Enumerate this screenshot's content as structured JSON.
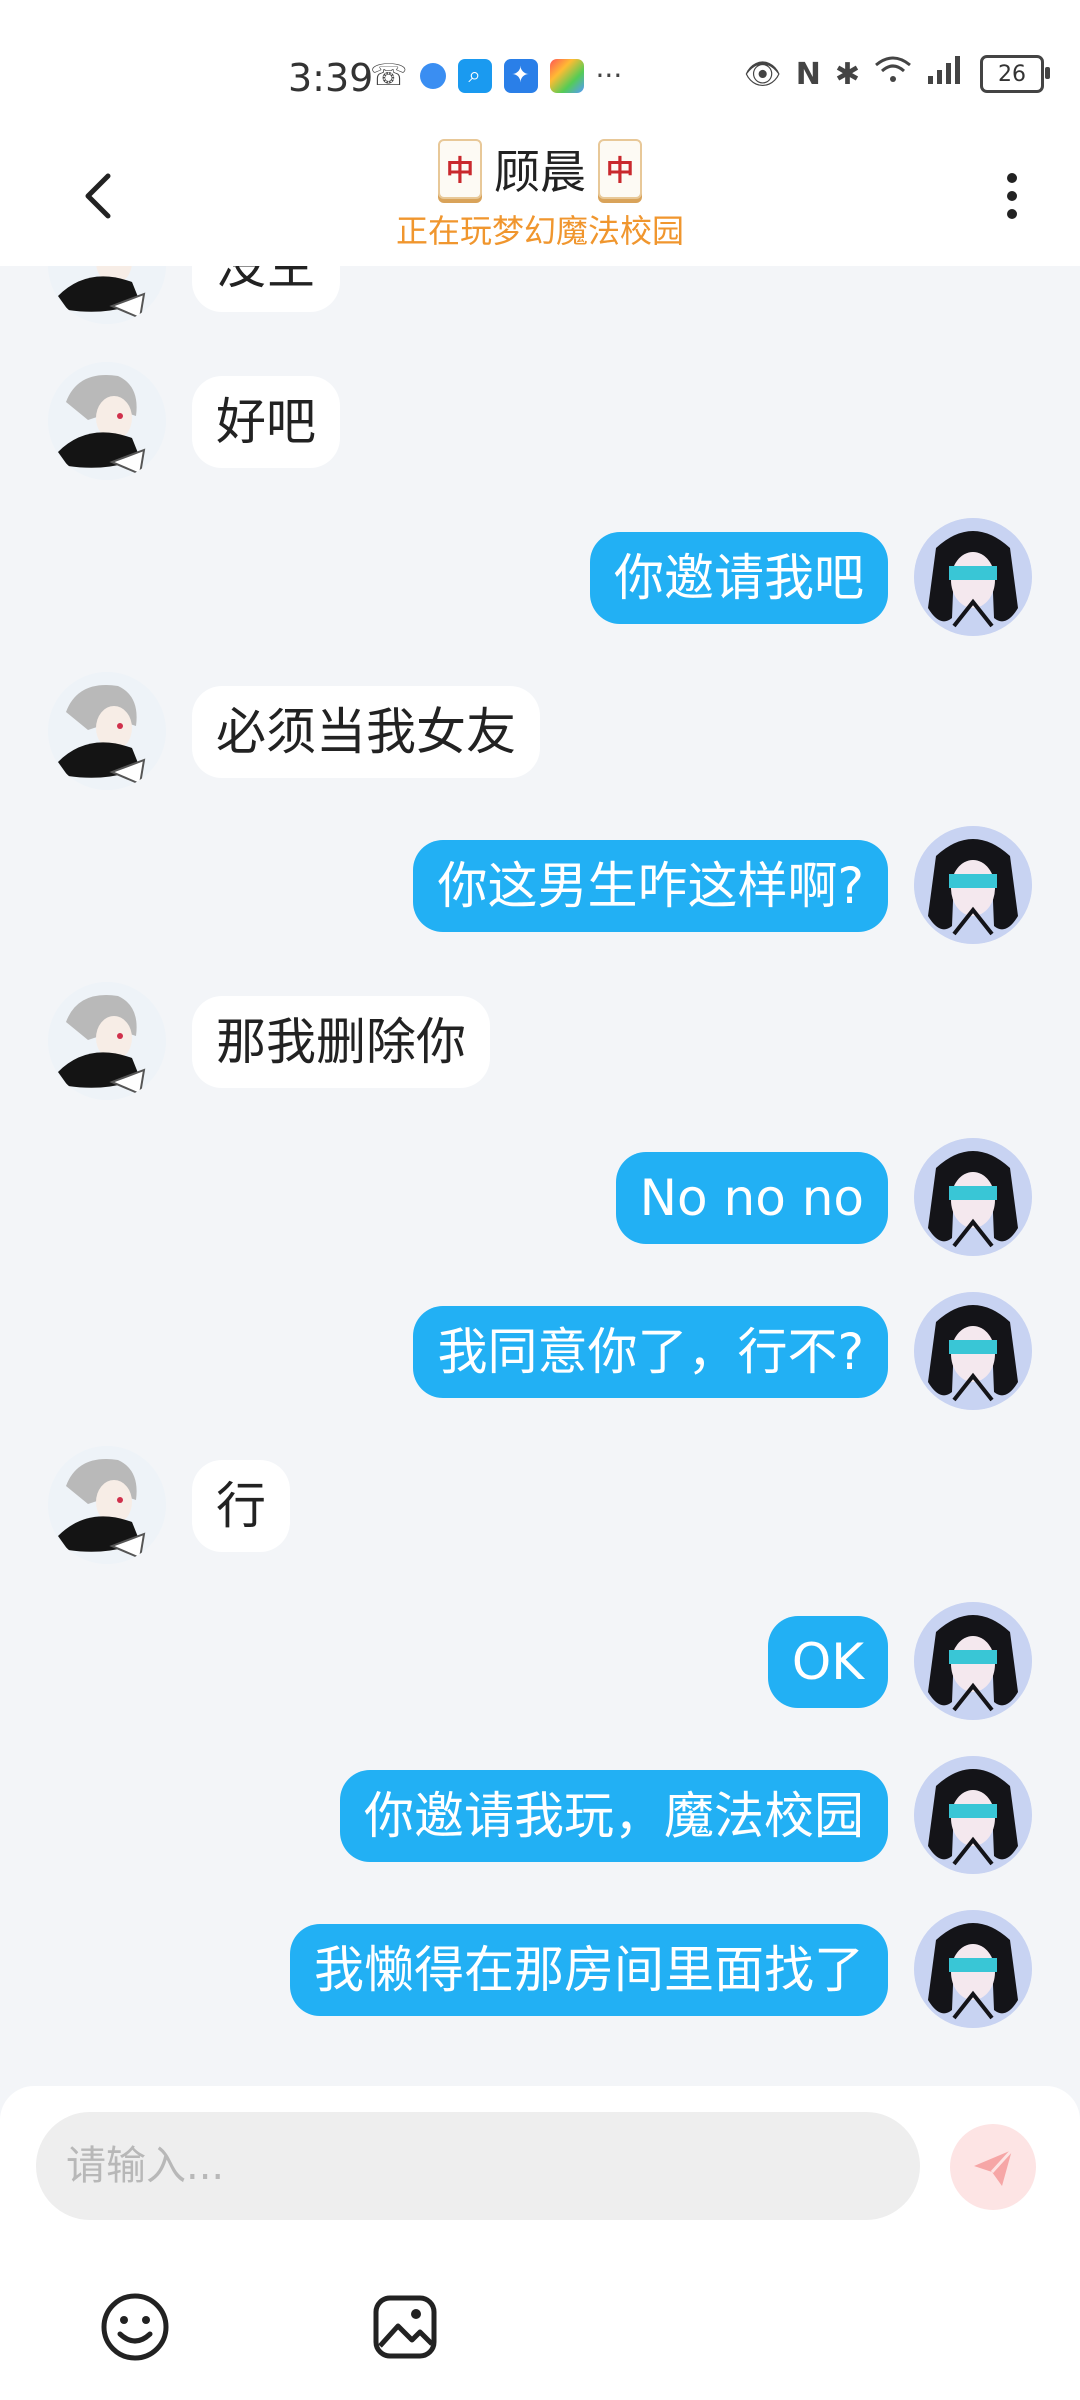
{
  "status_bar": {
    "time": "3:39",
    "battery": "26"
  },
  "header": {
    "title": "顾晨",
    "tile_char": "中",
    "subtitle": "正在玩梦幻魔法校园"
  },
  "messages": [
    {
      "side": "left",
      "text": "没空"
    },
    {
      "side": "left",
      "text": "好吧"
    },
    {
      "side": "right",
      "text": "你邀请我吧"
    },
    {
      "side": "left",
      "text": "必须当我女友"
    },
    {
      "side": "right",
      "text": "你这男生咋这样啊?"
    },
    {
      "side": "left",
      "text": "那我删除你"
    },
    {
      "side": "right",
      "text": "No no no"
    },
    {
      "side": "right",
      "text": "我同意你了，行不?"
    },
    {
      "side": "left",
      "text": "行"
    },
    {
      "side": "right",
      "text": "OK"
    },
    {
      "side": "right",
      "text": "你邀请我玩，魔法校园"
    },
    {
      "side": "right",
      "text": "我懒得在那房间里面找了"
    }
  ],
  "input": {
    "placeholder": "请输入..."
  },
  "icons": {
    "back": "back-arrow-icon",
    "menu": "more-vertical-icon",
    "send": "send-icon",
    "emoji": "emoji-icon",
    "image": "image-icon"
  },
  "colors": {
    "accent_blue": "#22b0f4",
    "subtitle_orange": "#f0962e",
    "send_bg": "#fde4e4",
    "send_fg": "#f6a6a6"
  }
}
